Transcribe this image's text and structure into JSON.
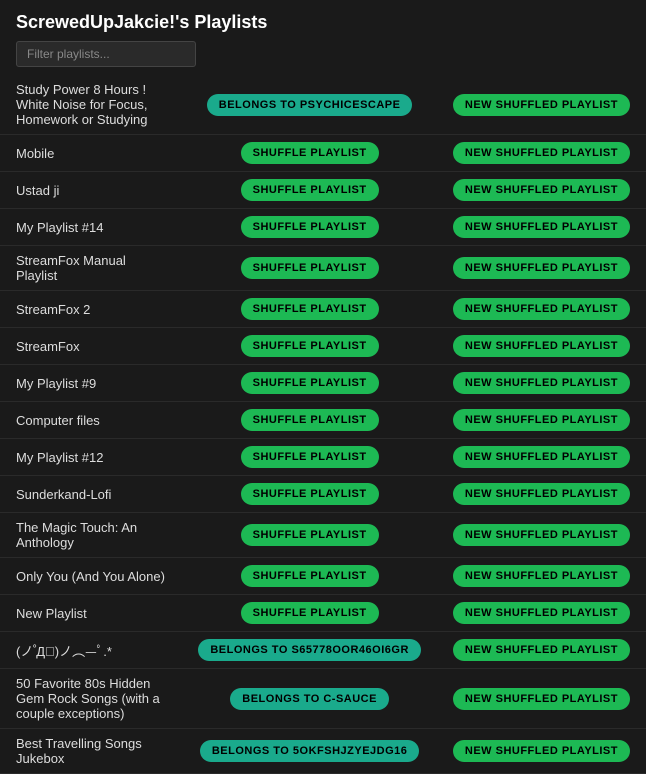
{
  "header": {
    "title": "ScrewedUpJakcie!'s Playlists",
    "search_placeholder": "Filter playlists..."
  },
  "playlists": [
    {
      "name": "Study Power 8 Hours ! White Noise for Focus, Homework or Studying",
      "action": "BELONGS TO PSYCHICESCAPE",
      "action_type": "teal",
      "new_shuffled": "NEW SHUFFLED PLAYLIST"
    },
    {
      "name": "Mobile",
      "action": "SHUFFLE PLAYLIST",
      "action_type": "green",
      "new_shuffled": "NEW SHUFFLED PLAYLIST"
    },
    {
      "name": "Ustad ji",
      "action": "SHUFFLE PLAYLIST",
      "action_type": "green",
      "new_shuffled": "NEW SHUFFLED PLAYLIST"
    },
    {
      "name": "My Playlist #14",
      "action": "SHUFFLE PLAYLIST",
      "action_type": "green",
      "new_shuffled": "NEW SHUFFLED PLAYLIST"
    },
    {
      "name": "StreamFox Manual Playlist",
      "action": "SHUFFLE PLAYLIST",
      "action_type": "green",
      "new_shuffled": "NEW SHUFFLED PLAYLIST"
    },
    {
      "name": "StreamFox 2",
      "action": "SHUFFLE PLAYLIST",
      "action_type": "green",
      "new_shuffled": "NEW SHUFFLED PLAYLIST"
    },
    {
      "name": "StreamFox",
      "action": "SHUFFLE PLAYLIST",
      "action_type": "green",
      "new_shuffled": "NEW SHUFFLED PLAYLIST"
    },
    {
      "name": "My Playlist #9",
      "action": "SHUFFLE PLAYLIST",
      "action_type": "green",
      "new_shuffled": "NEW SHUFFLED PLAYLIST"
    },
    {
      "name": "Computer files",
      "action": "SHUFFLE PLAYLIST",
      "action_type": "green",
      "new_shuffled": "NEW SHUFFLED PLAYLIST"
    },
    {
      "name": "My Playlist #12",
      "action": "SHUFFLE PLAYLIST",
      "action_type": "green",
      "new_shuffled": "NEW SHUFFLED PLAYLIST"
    },
    {
      "name": "Sunderkand-Lofi",
      "action": "SHUFFLE PLAYLIST",
      "action_type": "green",
      "new_shuffled": "NEW SHUFFLED PLAYLIST"
    },
    {
      "name": "The Magic Touch: An Anthology",
      "action": "SHUFFLE PLAYLIST",
      "action_type": "green",
      "new_shuffled": "NEW SHUFFLED PLAYLIST"
    },
    {
      "name": "Only You (And You Alone)",
      "action": "SHUFFLE PLAYLIST",
      "action_type": "green",
      "new_shuffled": "NEW SHUFFLED PLAYLIST"
    },
    {
      "name": "New Playlist",
      "action": "SHUFFLE PLAYLIST",
      "action_type": "green",
      "new_shuffled": "NEW SHUFFLED PLAYLIST"
    },
    {
      "name": "(ノ ゚Д゚)ノ︵—ﾟ.*",
      "action": "BELONGS TO S65778OOR46OI6GR",
      "action_type": "teal",
      "new_shuffled": "NEW SHUFFLED PLAYLIST"
    },
    {
      "name": "50 Favorite 80s Hidden Gem Rock Songs (with a couple exceptions)",
      "action": "BELONGS TO C-SAUCE",
      "action_type": "teal",
      "new_shuffled": "NEW SHUFFLED PLAYLIST"
    },
    {
      "name": "Best Travelling Songs Jukebox",
      "action": "BELONGS TO 5OKFSHJZYEJDG16",
      "action_type": "teal",
      "new_shuffled": "NEW SHUFFLED PLAYLIST"
    }
  ]
}
